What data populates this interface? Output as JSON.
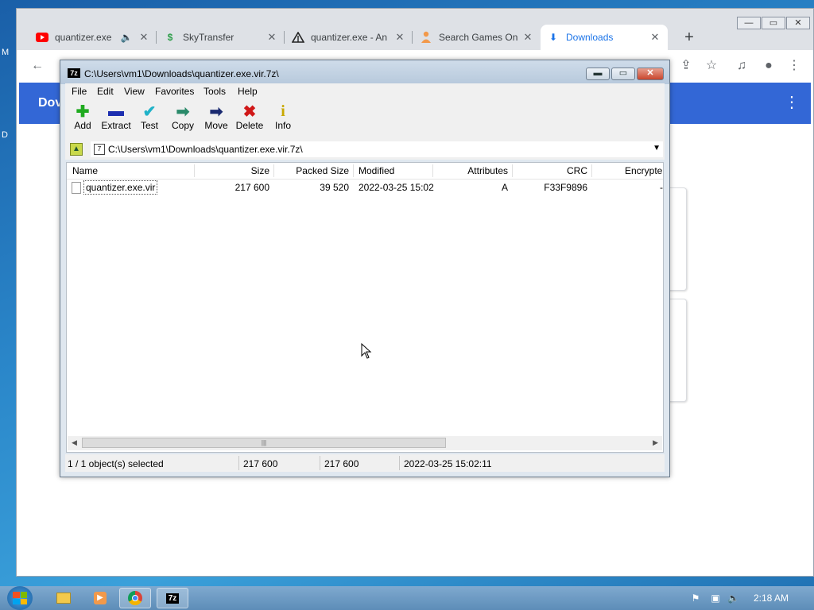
{
  "desktop": {
    "left_letters": [
      "M",
      "D"
    ]
  },
  "chrome": {
    "tabs": [
      {
        "label": "quantizer.exe",
        "icon": "youtube-icon",
        "audio": "🔈"
      },
      {
        "label": "SkyTransfer",
        "icon": "skytransfer-icon"
      },
      {
        "label": "quantizer.exe - An",
        "icon": "analysis-icon"
      },
      {
        "label": "Search Games On",
        "icon": "person-icon"
      },
      {
        "label": "Downloads",
        "icon": "download-icon"
      }
    ],
    "new_tab": "+",
    "page": {
      "title": "Dov"
    }
  },
  "sevenzip": {
    "title": "C:\\Users\\vm1\\Downloads\\quantizer.exe.vir.7z\\",
    "app_icon": "7z",
    "menu": [
      "File",
      "Edit",
      "View",
      "Favorites",
      "Tools",
      "Help"
    ],
    "toolbar": [
      {
        "label": "Add",
        "icon": "add-icon",
        "glyph": "✚",
        "color": "#1faa1f"
      },
      {
        "label": "Extract",
        "icon": "extract-icon",
        "glyph": "▬",
        "color": "#1d2fb0"
      },
      {
        "label": "Test",
        "icon": "test-icon",
        "glyph": "✔",
        "color": "#20b2c8"
      },
      {
        "label": "Copy",
        "icon": "copy-icon",
        "glyph": "➡",
        "color": "#2a8a6a"
      },
      {
        "label": "Move",
        "icon": "move-icon",
        "glyph": "➡",
        "color": "#1a2a70"
      },
      {
        "label": "Delete",
        "icon": "delete-icon",
        "glyph": "✖",
        "color": "#d01818"
      },
      {
        "label": "Info",
        "icon": "info-icon",
        "glyph": "i",
        "color": "#c8a800"
      }
    ],
    "path": "C:\\Users\\vm1\\Downloads\\quantizer.exe.vir.7z\\",
    "columns": [
      "Name",
      "Size",
      "Packed Size",
      "Modified",
      "Attributes",
      "CRC",
      "Encrypte"
    ],
    "rows": [
      {
        "name": "quantizer.exe.vir",
        "size": "217 600",
        "packed": "39 520",
        "modified": "2022-03-25 15:02",
        "attributes": "A",
        "crc": "F33F9896",
        "encrypted": "-"
      }
    ],
    "status": {
      "selected": "1 / 1 object(s) selected",
      "size": "217 600",
      "packed": "217 600",
      "modified": "2022-03-25 15:02:11"
    }
  },
  "taskbar": {
    "clock": "2:18 AM"
  }
}
